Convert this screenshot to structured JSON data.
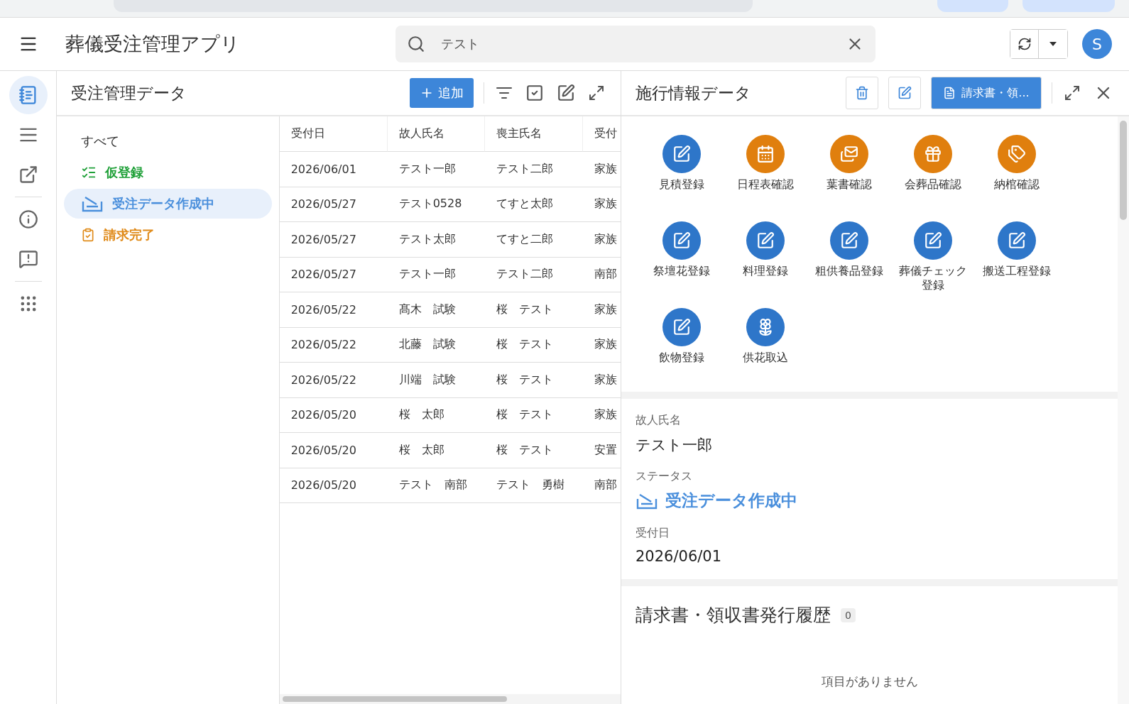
{
  "app_bar": {
    "title": "葬儀受注管理アプリ",
    "search": {
      "value": "テスト"
    },
    "avatar": "S"
  },
  "rail": {
    "items": [
      {
        "selected": true
      },
      {
        "selected": false
      },
      {
        "selected": false
      },
      {
        "selected": false
      },
      {
        "selected": false
      },
      {
        "selected": false
      }
    ]
  },
  "list_view": {
    "title": "受注管理データ",
    "add_button": "追加",
    "groups": [
      {
        "label": "すべて",
        "kind": "plain",
        "selected": false
      },
      {
        "label": "仮登録",
        "kind": "draft",
        "color": "#1fa038",
        "selected": false
      },
      {
        "label": "受注データ作成中",
        "kind": "inprogress",
        "color": "#4a8fdc",
        "selected": true
      },
      {
        "label": "請求完了",
        "kind": "billed",
        "color": "#e08b1a",
        "selected": false
      }
    ]
  },
  "table": {
    "columns": [
      "受付日",
      "故人氏名",
      "喪主氏名",
      "受付"
    ],
    "rows": [
      [
        "2026/06/01",
        "テスト一郎",
        "テスト二郎",
        "家族"
      ],
      [
        "2026/05/27",
        "テスト0528",
        "てすと太郎",
        "家族"
      ],
      [
        "2026/05/27",
        "テスト太郎",
        "てすと二郎",
        "家族"
      ],
      [
        "2026/05/27",
        "テスト一郎",
        "テスト二郎",
        "南部"
      ],
      [
        "2026/05/22",
        "髙木　試験",
        "桜　テスト",
        "家族"
      ],
      [
        "2026/05/22",
        "北藤　試験",
        "桜　テスト",
        "家族"
      ],
      [
        "2026/05/22",
        "川端　試験",
        "桜　テスト",
        "家族"
      ],
      [
        "2026/05/20",
        "桜　太郎",
        "桜　テスト",
        "家族"
      ],
      [
        "2026/05/20",
        "桜　太郎",
        "桜　テスト",
        "安置"
      ],
      [
        "2026/05/20",
        "テスト　南部",
        "テスト　勇樹",
        "南部"
      ]
    ]
  },
  "detail": {
    "title": "施行情報データ",
    "invoice_button": "請求書・領...",
    "actions": [
      {
        "label": "見積登録",
        "color": "#2e76c9"
      },
      {
        "label": "日程表確認",
        "color": "#e07f0e"
      },
      {
        "label": "葉書確認",
        "color": "#e07f0e"
      },
      {
        "label": "会葬品確認",
        "color": "#e07f0e"
      },
      {
        "label": "納棺確認",
        "color": "#e07f0e"
      },
      {
        "label": "祭壇花登録",
        "color": "#2e76c9"
      },
      {
        "label": "料理登録",
        "color": "#2e76c9"
      },
      {
        "label": "粗供養品登録",
        "color": "#2e76c9"
      },
      {
        "label": "葬儀チェック登録",
        "color": "#2e76c9"
      },
      {
        "label": "搬送工程登録",
        "color": "#2e76c9"
      },
      {
        "label": "飲物登録",
        "color": "#2e76c9"
      },
      {
        "label": "供花取込",
        "color": "#2e76c9"
      }
    ],
    "fields": [
      {
        "label": "故人氏名",
        "value": "テスト一郎",
        "kind": "text"
      },
      {
        "label": "ステータス",
        "value": "受注データ作成中",
        "kind": "status"
      },
      {
        "label": "受付日",
        "value": "2026/06/01",
        "kind": "text"
      }
    ],
    "history": {
      "title": "請求書・領収書発行履歴",
      "count": "0",
      "empty": "項目がありません"
    }
  }
}
